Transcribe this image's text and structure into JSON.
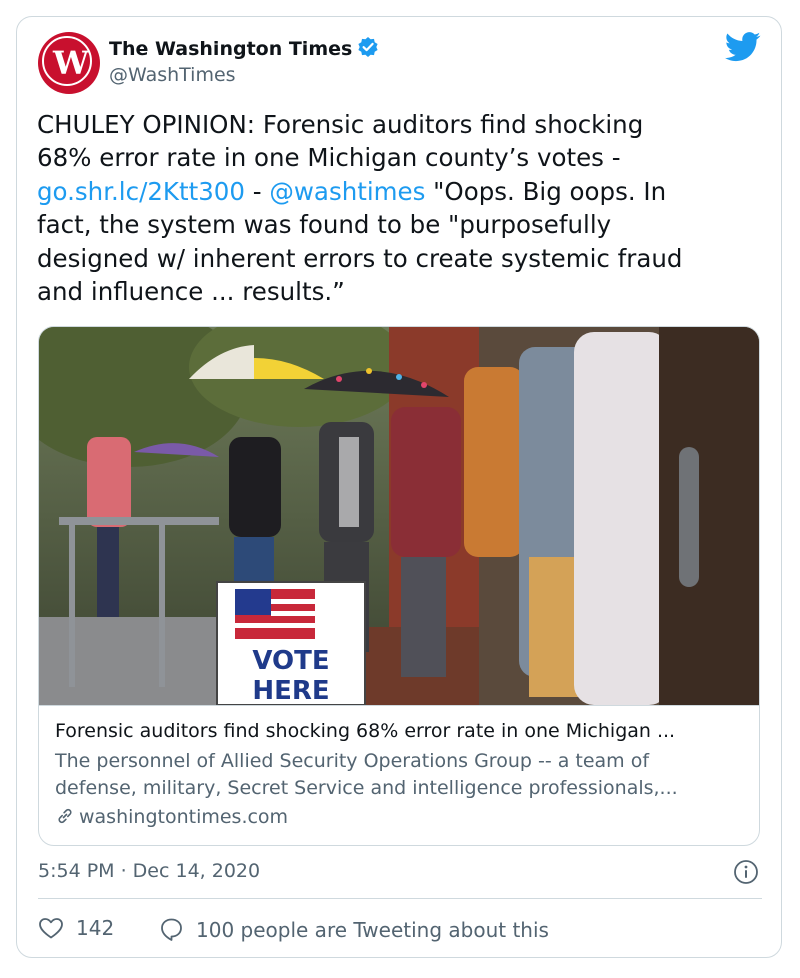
{
  "account": {
    "name": "The Washington Times",
    "handle": "@WashTimes",
    "avatar_monogram": "W",
    "brand_color": "#c8102e",
    "verified_icon": "verified-badge-icon",
    "platform_icon": "twitter-bird-icon"
  },
  "tweet": {
    "lines": [
      {
        "segments": [
          {
            "text": "CHULEY OPINION: Forensic auditors find shocking",
            "link": false
          }
        ]
      },
      {
        "segments": [
          {
            "text": "68% error rate in one Michigan county’s votes -",
            "link": false
          }
        ]
      },
      {
        "segments": [
          {
            "text": "go.shr.lc/2Ktt300",
            "link": true
          },
          {
            "text": " - ",
            "link": false
          },
          {
            "text": "@washtimes",
            "link": true
          },
          {
            "text": " \"Oops. Big oops. In",
            "link": false
          }
        ]
      },
      {
        "segments": [
          {
            "text": "fact, the system was found to be \"purposefully",
            "link": false
          }
        ]
      },
      {
        "segments": [
          {
            "text": "designed w/ inherent errors to create systemic fraud",
            "link": false
          }
        ]
      },
      {
        "segments": [
          {
            "text": "and influence ... results.”",
            "link": false
          }
        ]
      }
    ],
    "link_color": "#1d9bf0"
  },
  "link_card": {
    "image_sign_text": [
      "VOTE",
      "HERE"
    ],
    "title": "Forensic auditors find shocking 68% error rate in one Michigan ...",
    "description_lines": [
      "The personnel of Allied Security Operations Group -- a team of",
      "defense, military, Secret Service and intelligence professionals,..."
    ],
    "domain": "washingtontimes.com",
    "domain_icon": "link-icon"
  },
  "timestamp": "5:54 PM · Dec 14, 2020",
  "info_icon": "info-icon",
  "engagement": {
    "likes": "142",
    "like_icon": "heart-icon",
    "conversation": "100 people are Tweeting about this",
    "conversation_icon": "speech-bubble-icon"
  }
}
